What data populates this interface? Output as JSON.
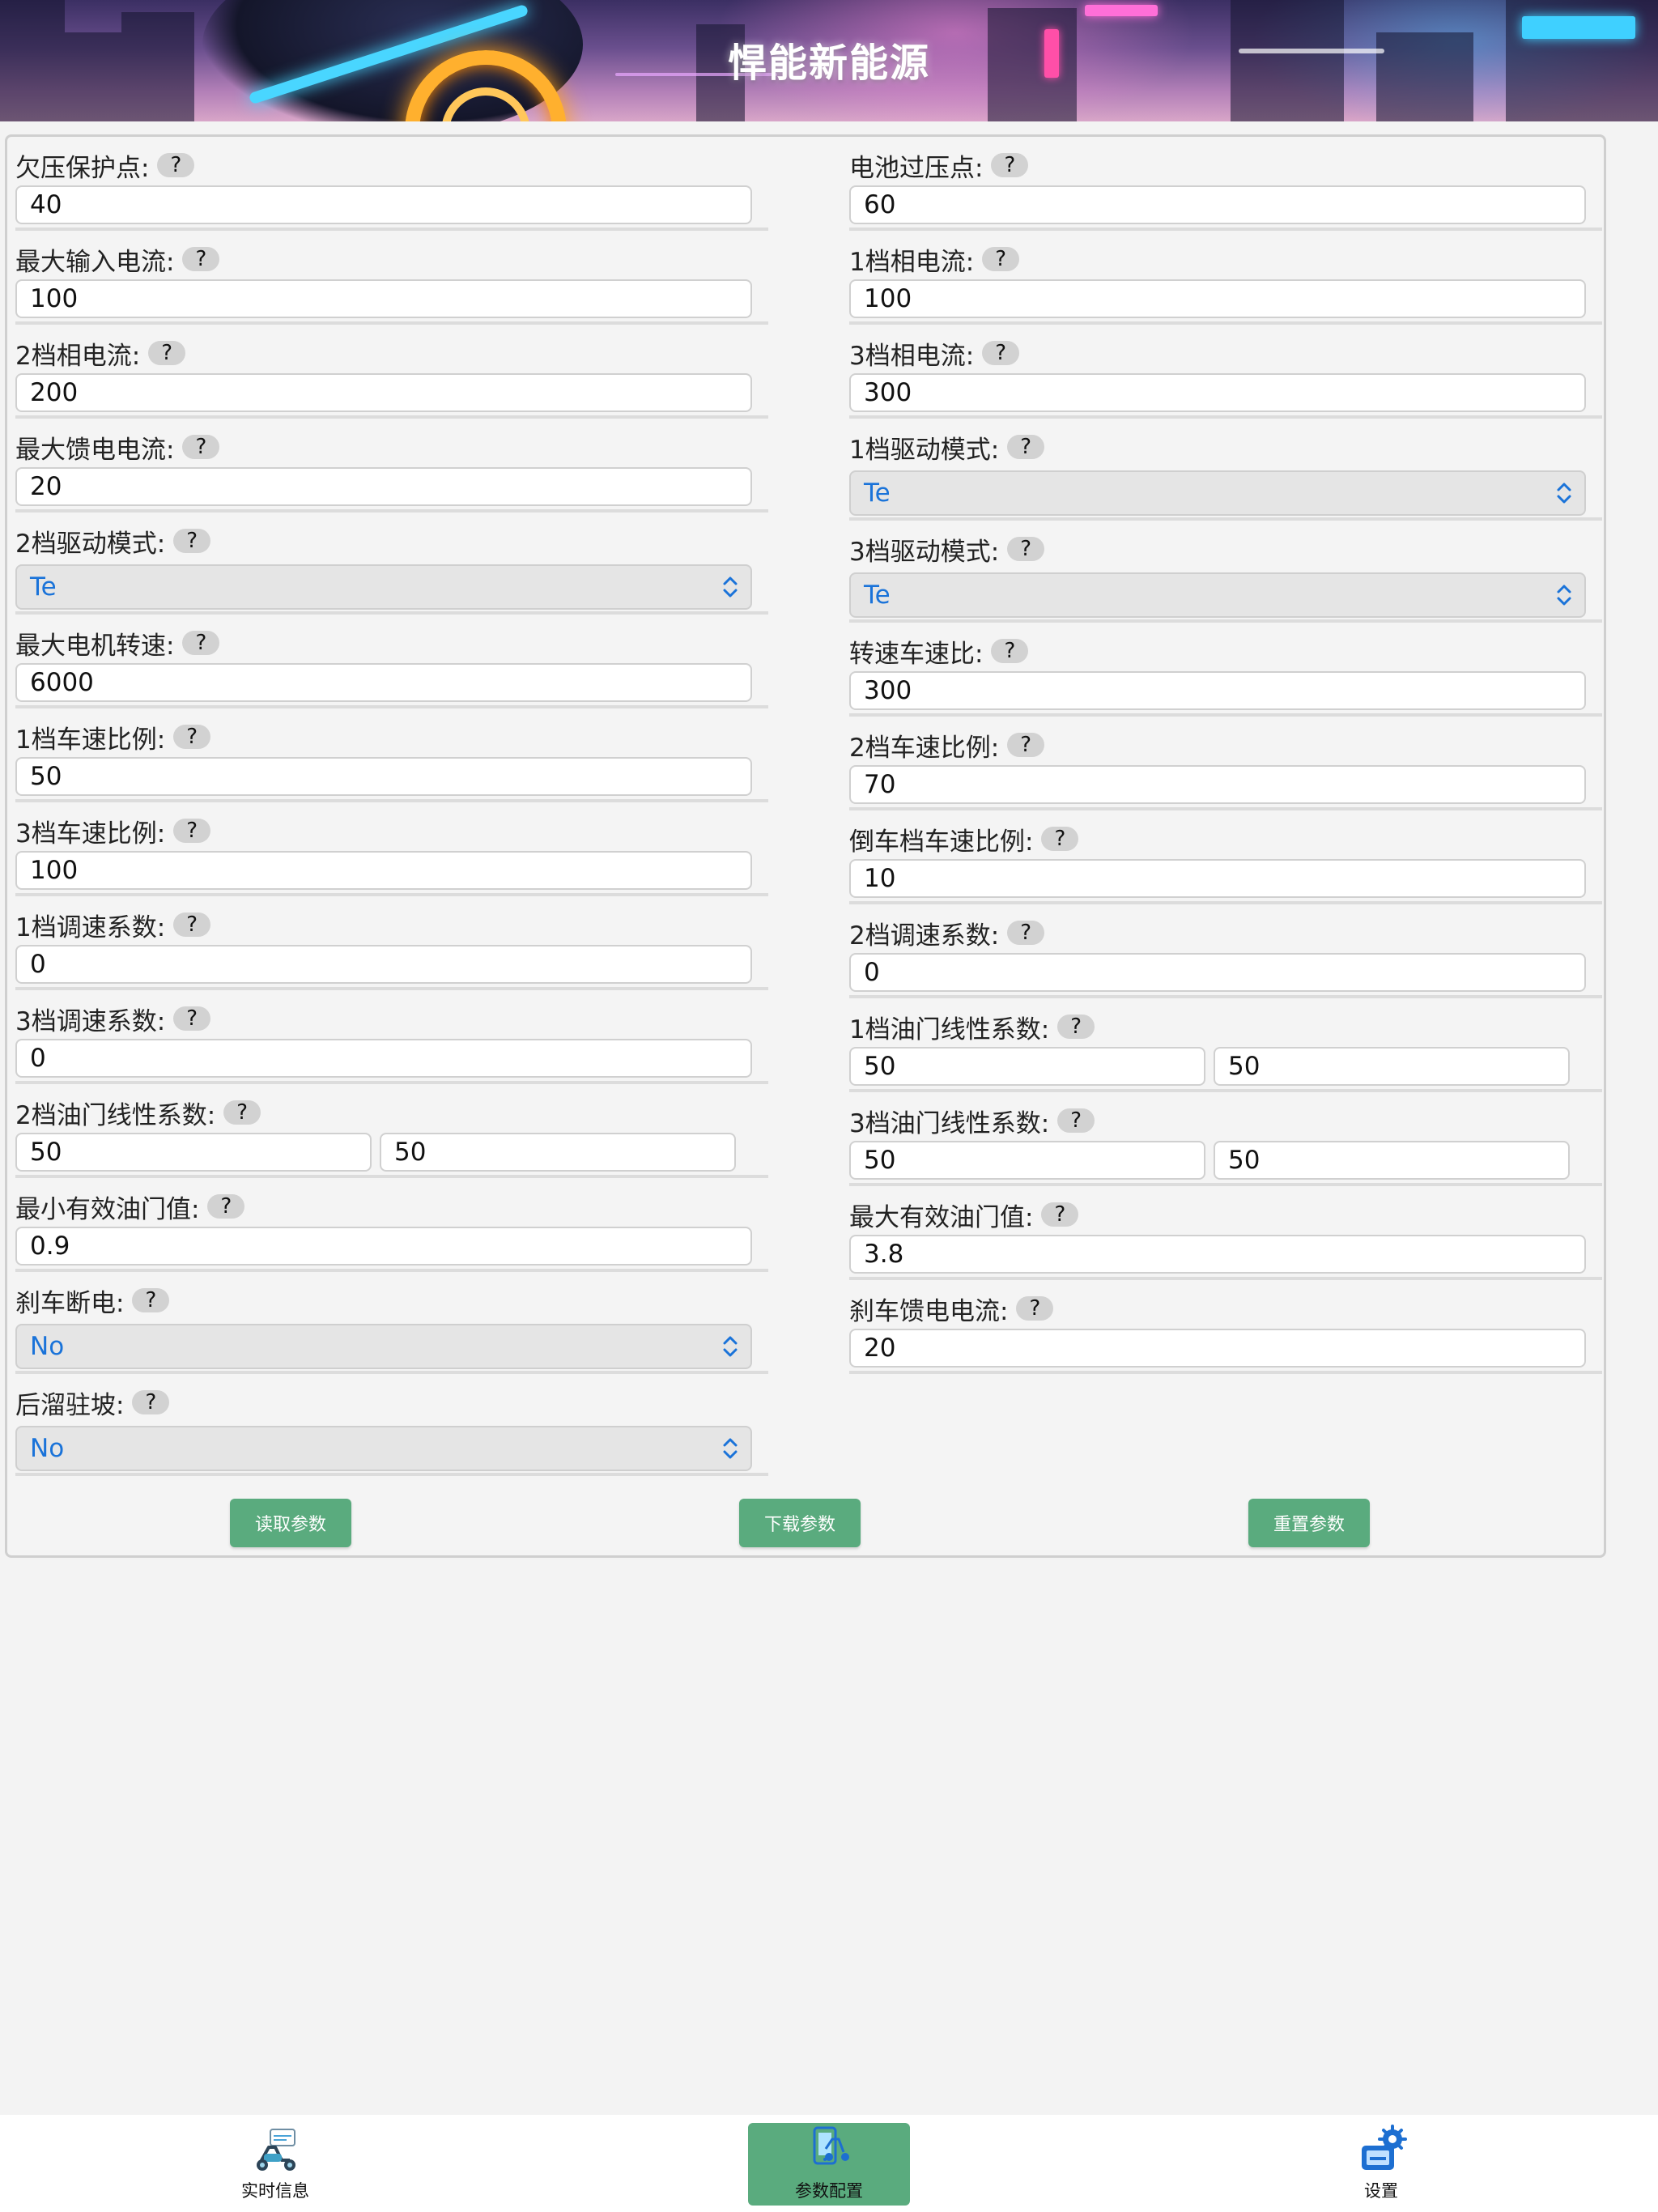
{
  "header": {
    "title": "悍能新能源"
  },
  "form": {
    "left": [
      {
        "type": "input",
        "label": "欠压保护点:",
        "value": "40"
      },
      {
        "type": "input",
        "label": "最大输入电流:",
        "value": "100"
      },
      {
        "type": "input",
        "label": "2档相电流:",
        "value": "200"
      },
      {
        "type": "input",
        "label": "最大馈电电流:",
        "value": "20"
      },
      {
        "type": "select",
        "label": "2档驱动模式:",
        "value": "Te"
      },
      {
        "type": "input",
        "label": "最大电机转速:",
        "value": "6000"
      },
      {
        "type": "input",
        "label": "1档车速比例:",
        "value": "50"
      },
      {
        "type": "input",
        "label": "3档车速比例:",
        "value": "100"
      },
      {
        "type": "input",
        "label": "1档调速系数:",
        "value": "0"
      },
      {
        "type": "input",
        "label": "3档调速系数:",
        "value": "0"
      },
      {
        "type": "pair",
        "label": "2档油门线性系数:",
        "value": "50",
        "value2": "50"
      },
      {
        "type": "input",
        "label": "最小有效油门值:",
        "value": "0.9"
      },
      {
        "type": "select",
        "label": "刹车断电:",
        "value": "No"
      },
      {
        "type": "select",
        "label": "后溜驻坡:",
        "value": "No"
      }
    ],
    "right": [
      {
        "type": "input",
        "label": "电池过压点:",
        "value": "60"
      },
      {
        "type": "input",
        "label": "1档相电流:",
        "value": "100"
      },
      {
        "type": "input",
        "label": "3档相电流:",
        "value": "300"
      },
      {
        "type": "select",
        "label": "1档驱动模式:",
        "value": "Te"
      },
      {
        "type": "select",
        "label": "3档驱动模式:",
        "value": "Te"
      },
      {
        "type": "input",
        "label": "转速车速比:",
        "value": "300"
      },
      {
        "type": "input",
        "label": "2档车速比例:",
        "value": "70"
      },
      {
        "type": "input",
        "label": "倒车档车速比例:",
        "value": "10"
      },
      {
        "type": "input",
        "label": "2档调速系数:",
        "value": "0"
      },
      {
        "type": "pair",
        "label": "1档油门线性系数:",
        "value": "50",
        "value2": "50"
      },
      {
        "type": "pair",
        "label": "3档油门线性系数:",
        "value": "50",
        "value2": "50"
      },
      {
        "type": "input",
        "label": "最大有效油门值:",
        "value": "3.8"
      },
      {
        "type": "input",
        "label": "刹车馈电电流:",
        "value": "20"
      }
    ],
    "help_glyph": "?"
  },
  "actions": {
    "read": "读取参数",
    "download": "下载参数",
    "reset": "重置参数"
  },
  "tabs": {
    "realtime": "实时信息",
    "params": "参数配置",
    "settings": "设置"
  },
  "colors": {
    "accent_green": "#5aab7e",
    "select_text_blue": "#1a73d9"
  }
}
